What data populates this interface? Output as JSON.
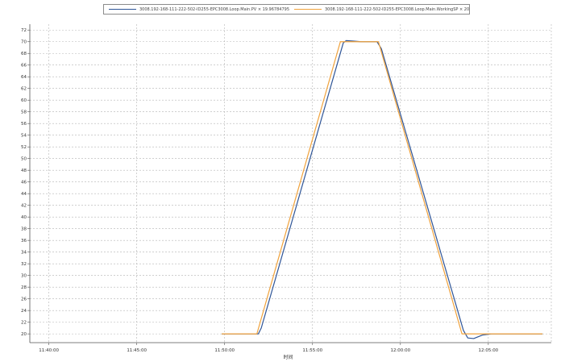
{
  "chart_data": {
    "type": "line",
    "title": "",
    "xlabel": "时间",
    "ylabel": "",
    "ylim": [
      18.5,
      73
    ],
    "yticks": [
      20,
      22,
      24,
      26,
      28,
      30,
      32,
      34,
      36,
      38,
      40,
      42,
      44,
      46,
      48,
      50,
      52,
      54,
      56,
      58,
      60,
      62,
      64,
      66,
      68,
      70,
      72
    ],
    "xlim": [
      "11:38:55",
      "12:08:35"
    ],
    "xticks": [
      "11:40:00",
      "11:45:00",
      "11:50:00",
      "11:55:00",
      "12:00:00",
      "12:05:00"
    ],
    "grid": true,
    "legend_position": "top",
    "series": [
      {
        "name": "3008.192-168-111-222-502-ID255-EPC3008.Loop.Main.PV × 19.96784795",
        "color": "#2f5597",
        "points": [
          [
            "11:49:50",
            20
          ],
          [
            "11:51:55",
            20
          ],
          [
            "11:52:05",
            21
          ],
          [
            "11:56:45",
            69.8
          ],
          [
            "11:56:55",
            70.2
          ],
          [
            "11:57:20",
            70.1
          ],
          [
            "11:57:45",
            70
          ],
          [
            "11:58:40",
            70
          ],
          [
            "11:58:55",
            68.8
          ],
          [
            "12:03:35",
            20.6
          ],
          [
            "12:03:50",
            19.3
          ],
          [
            "12:04:10",
            19.2
          ],
          [
            "12:04:40",
            19.8
          ],
          [
            "12:05:10",
            20
          ],
          [
            "12:08:05",
            20
          ]
        ]
      },
      {
        "name": "3008.192-168-111-222-502-ID255-EPC3008.Loop.Main.WorkingSP × 20",
        "color": "#f0a23c",
        "points": [
          [
            "11:49:50",
            20
          ],
          [
            "11:51:50",
            20
          ],
          [
            "11:56:35",
            70
          ],
          [
            "11:58:45",
            70
          ],
          [
            "12:03:30",
            20
          ],
          [
            "12:08:05",
            20
          ]
        ]
      }
    ]
  }
}
